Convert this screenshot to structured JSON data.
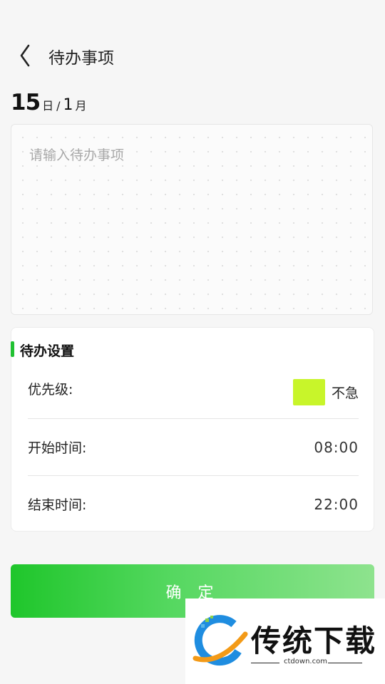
{
  "header": {
    "title": "待办事项"
  },
  "date": {
    "day": "15",
    "day_unit": "日",
    "separator": "/",
    "month": "1",
    "month_unit": "月"
  },
  "note": {
    "placeholder": "请输入待办事项",
    "value": ""
  },
  "settings": {
    "title": "待办设置",
    "accent_color": "#21c132",
    "priority": {
      "label": "优先级:",
      "value": "不急",
      "color": "#c8f52a"
    },
    "start_time": {
      "label": "开始时间:",
      "value": "08:00"
    },
    "end_time": {
      "label": "结束时间:",
      "value": "22:00"
    }
  },
  "confirm_button": {
    "label": "确 定"
  },
  "watermark": {
    "name": "传统下载",
    "url": "ctdown.com"
  }
}
